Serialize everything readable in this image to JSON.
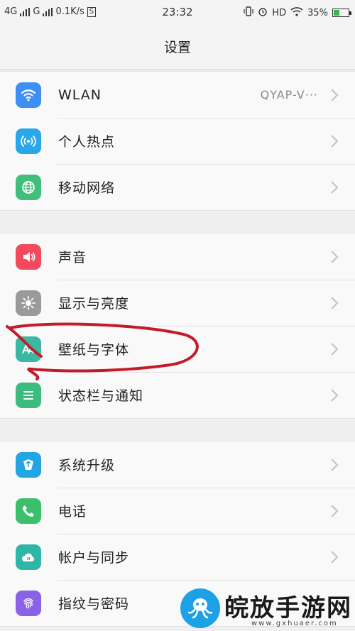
{
  "status_bar": {
    "network1": "4G",
    "network2": "G",
    "speed": "0.1K/s",
    "s_badge": "S",
    "time": "23:32",
    "hd": "HD",
    "battery": "35%",
    "battery_level": 0.35
  },
  "header": {
    "title": "设置"
  },
  "groups": [
    {
      "items": [
        {
          "label": "WLAN",
          "value": "QYAP-V···",
          "icon": "wifi-icon",
          "color": "#3f8ef3"
        },
        {
          "label": "个人热点",
          "icon": "hotspot-icon",
          "color": "#29a7e8"
        },
        {
          "label": "移动网络",
          "icon": "globe-icon",
          "color": "#3fbf7a"
        }
      ]
    },
    {
      "items": [
        {
          "label": "声音",
          "icon": "speaker-icon",
          "color": "#f24a5c"
        },
        {
          "label": "显示与亮度",
          "icon": "brightness-icon",
          "color": "#9a9a9a"
        },
        {
          "label": "壁纸与字体",
          "icon": "font-icon",
          "color": "#3ab8a2"
        },
        {
          "label": "状态栏与通知",
          "icon": "list-icon",
          "color": "#3dba7e"
        }
      ]
    },
    {
      "items": [
        {
          "label": "系统升级",
          "icon": "upgrade-icon",
          "color": "#23a4e3"
        },
        {
          "label": "电话",
          "icon": "phone-icon",
          "color": "#3bbf6b"
        },
        {
          "label": "帐户与同步",
          "icon": "cloud-sync-icon",
          "color": "#2fb6a8"
        },
        {
          "label": "指纹与密码",
          "icon": "fingerprint-icon",
          "color": "#8a62e8"
        }
      ]
    }
  ],
  "watermark": {
    "text": "皖放手游网",
    "url": "www.gxhuaer.com"
  }
}
